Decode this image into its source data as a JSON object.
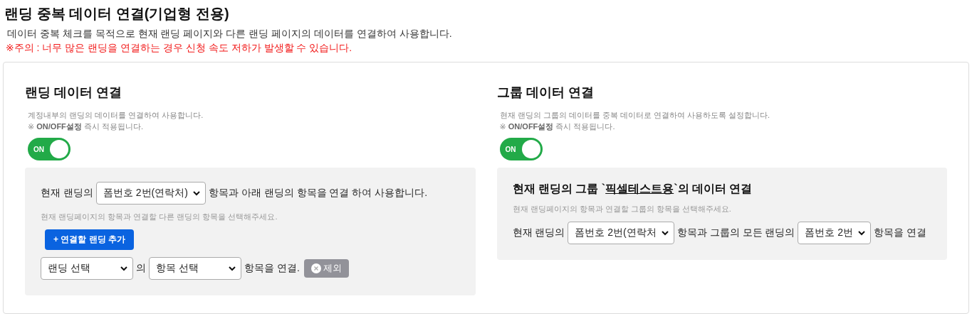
{
  "title": "랜딩 중복 데이터 연결(기업형 전용)",
  "description": "데이터 중복 체크를 목적으로 현재 랜딩 페이지와 다른 랜딩 페이지의 데이터를 연결하여 사용합니다.",
  "warning": "※주의 : 너무 많은 랜딩을 연결하는 경우 신청 속도 저하가 발생할 수 있습니다.",
  "panels": [
    {
      "title": "랜딩 데이터 연결",
      "description": "계정내부의 랜딩의 데이터를 연결하여 사용합니다.",
      "note": "※ **ON/OFF설정** 즉시 적용됩니다.",
      "toggle": {
        "label": "ON",
        "on": true
      },
      "items": [
        {
          "kind": "sentence",
          "parts": [
            {
              "kind": "text",
              "text": "현재 랜딩의"
            },
            {
              "kind": "select",
              "value": "폼번호 2번(연락처)"
            },
            {
              "kind": "text",
              "text": "항목과 아래 랜딩의 항목을 연결 하여 사용합니다."
            }
          ]
        },
        {
          "kind": "hint",
          "text": "현재 랜딩페이지의 항목과 연결할 다른 랜딩의 항목을 선택해주세요."
        },
        {
          "kind": "add",
          "label": "+ 연결할 랜딩 추가"
        },
        {
          "kind": "sentence",
          "parts": [
            {
              "kind": "select",
              "value": "랜딩 선택",
              "wide": true
            },
            {
              "kind": "text",
              "text": "의"
            },
            {
              "kind": "select",
              "value": "항목 선택",
              "wide": true
            },
            {
              "kind": "text",
              "text": "항목을 연결."
            },
            {
              "kind": "remove",
              "label": "제외"
            }
          ]
        }
      ]
    },
    {
      "title": "그룹 데이터 연결",
      "description": "현재 랜딩의 그룹의 데이터를 중복 데이터로 연결하여 사용하도록 설정합니다.",
      "note": "※ **ON/OFF설정** 즉시 적용됩니다.",
      "toggle": {
        "label": "ON",
        "on": true
      },
      "items": [
        {
          "kind": "heading",
          "before": "현재 랜딩의 그룹 `",
          "link": "픽셀테스트용",
          "after": "`의 데이터 연결"
        },
        {
          "kind": "hint",
          "text": "현재 랜딩페이지의 항목과 연결할 그룹의 항목을 선택해주세요."
        },
        {
          "kind": "sentence",
          "parts": [
            {
              "kind": "text",
              "text": "현재 랜딩의"
            },
            {
              "kind": "select",
              "value": "폼번호 2번(연락처"
            },
            {
              "kind": "text",
              "text": "항목과 그룹의 모든 랜딩의"
            },
            {
              "kind": "select",
              "value": "폼번호 2번"
            },
            {
              "kind": "text",
              "text": "항목을 연결"
            }
          ]
        }
      ]
    }
  ]
}
